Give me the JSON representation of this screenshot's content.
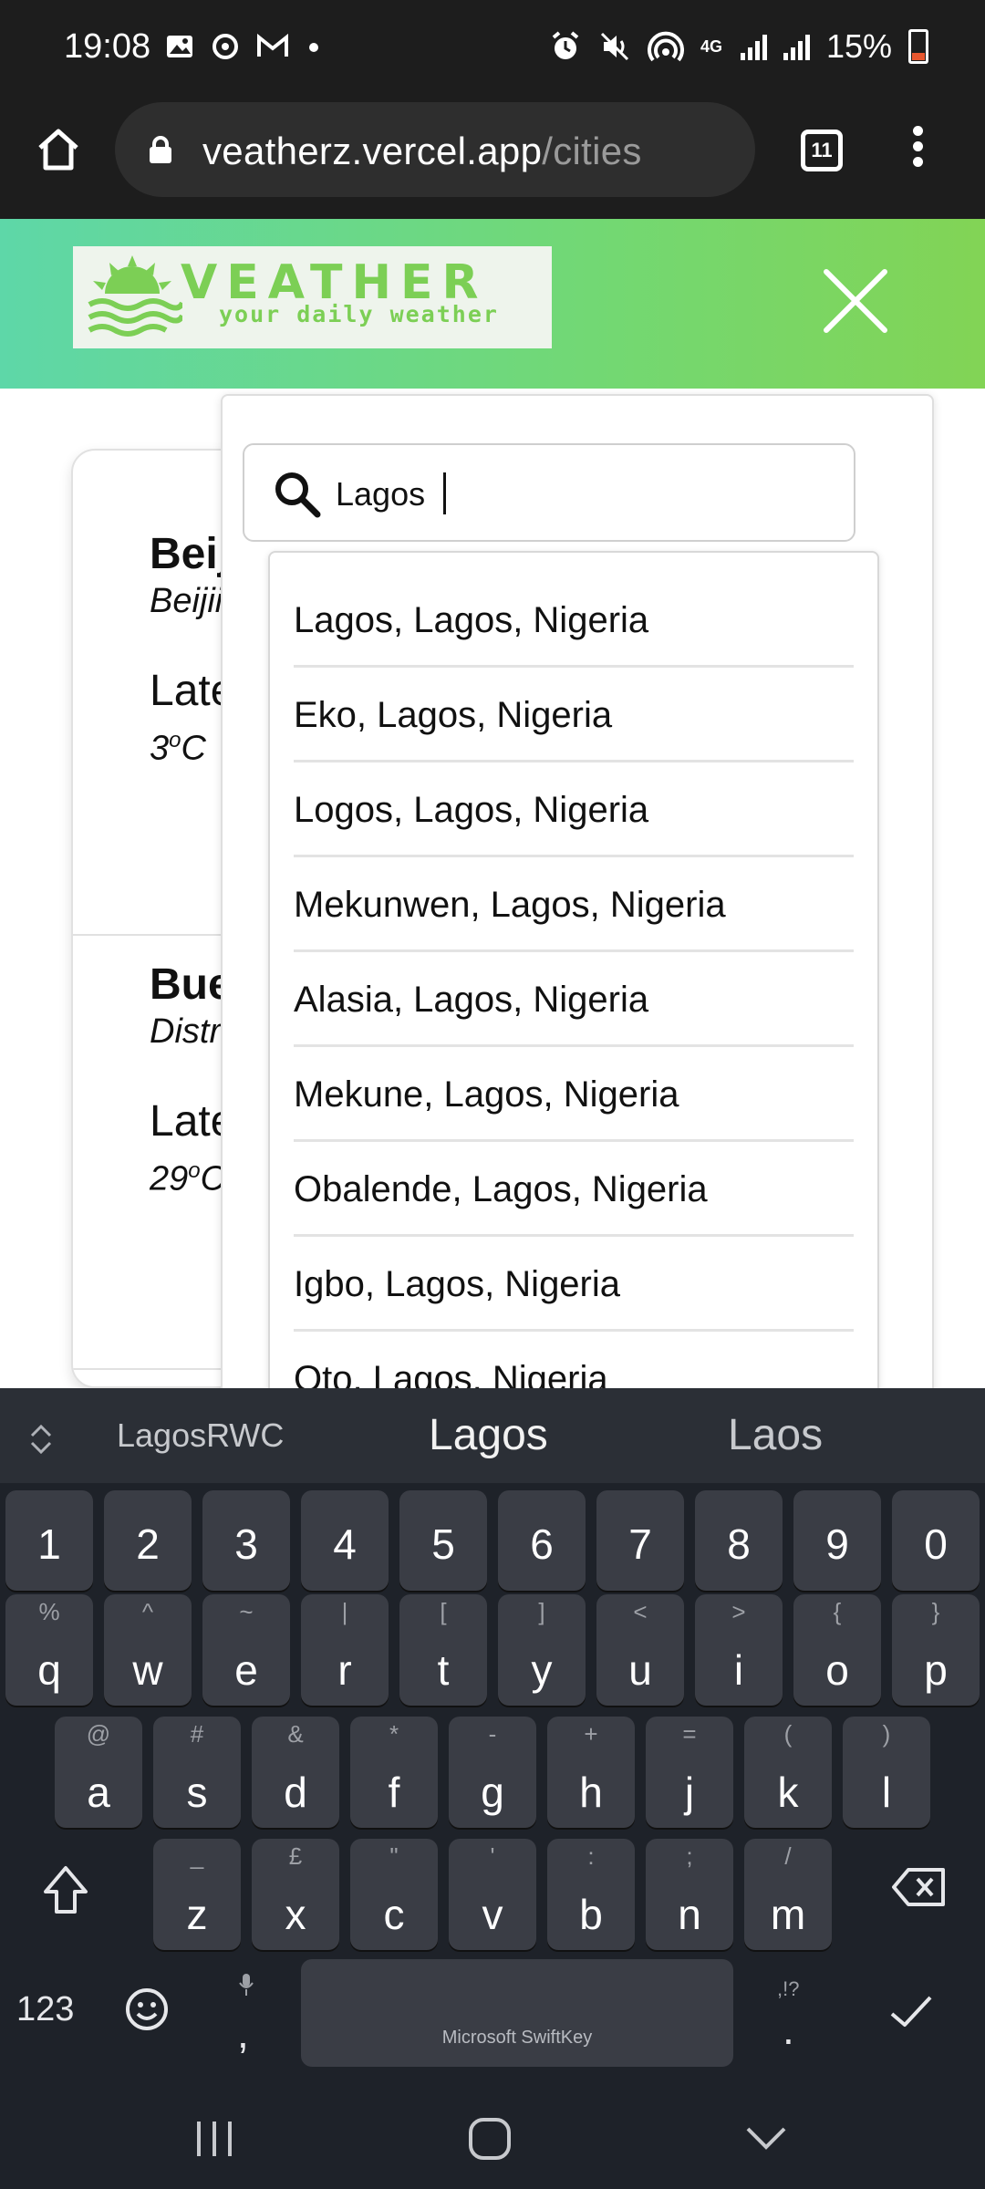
{
  "status_bar": {
    "time": "19:08",
    "battery": "15%",
    "network": "4G"
  },
  "browser": {
    "url_domain": "veatherz.vercel.app",
    "url_path": "/cities",
    "tab_count": "11"
  },
  "header": {
    "logo_word": "VEATHER",
    "logo_tagline": "your daily weather"
  },
  "cards": [
    {
      "name": "Beij",
      "subtitle": "Beijii",
      "label": "Late",
      "temp": "3",
      "unit": "C"
    },
    {
      "name": "Bue",
      "subtitle": "Distr",
      "label": "Late",
      "temp": "29",
      "unit": "C"
    }
  ],
  "search": {
    "value": "Lagos"
  },
  "results": [
    "Lagos, Lagos, Nigeria",
    "Eko, Lagos, Nigeria",
    "Logos, Lagos, Nigeria",
    "Mekunwen, Lagos, Nigeria",
    "Alasia, Lagos, Nigeria",
    "Mekune, Lagos, Nigeria",
    "Obalende, Lagos, Nigeria",
    "Igbo, Lagos, Nigeria",
    "Oto, Lagos, Nigeria"
  ],
  "keyboard": {
    "suggestions": [
      "LagosRWC",
      "Lagos",
      "Laos"
    ],
    "number_row": [
      "1",
      "2",
      "3",
      "4",
      "5",
      "6",
      "7",
      "8",
      "9",
      "0"
    ],
    "row1": [
      {
        "main": "q",
        "alt": "%"
      },
      {
        "main": "w",
        "alt": "^"
      },
      {
        "main": "e",
        "alt": "~"
      },
      {
        "main": "r",
        "alt": "|"
      },
      {
        "main": "t",
        "alt": "["
      },
      {
        "main": "y",
        "alt": "]"
      },
      {
        "main": "u",
        "alt": "<"
      },
      {
        "main": "i",
        "alt": ">"
      },
      {
        "main": "o",
        "alt": "{"
      },
      {
        "main": "p",
        "alt": "}"
      }
    ],
    "row2": [
      {
        "main": "a",
        "alt": "@"
      },
      {
        "main": "s",
        "alt": "#"
      },
      {
        "main": "d",
        "alt": "&"
      },
      {
        "main": "f",
        "alt": "*"
      },
      {
        "main": "g",
        "alt": "-"
      },
      {
        "main": "h",
        "alt": "+"
      },
      {
        "main": "j",
        "alt": "="
      },
      {
        "main": "k",
        "alt": "("
      },
      {
        "main": "l",
        "alt": ")"
      }
    ],
    "row3": [
      {
        "main": "z",
        "alt": "_"
      },
      {
        "main": "x",
        "alt": "£"
      },
      {
        "main": "c",
        "alt": "\""
      },
      {
        "main": "v",
        "alt": "'"
      },
      {
        "main": "b",
        "alt": ":"
      },
      {
        "main": "n",
        "alt": ";"
      },
      {
        "main": "m",
        "alt": "/"
      }
    ],
    "symbols_label": "123",
    "comma": ",",
    "period": ".",
    "period_alt": ",!?",
    "space_label": "Microsoft SwiftKey"
  }
}
